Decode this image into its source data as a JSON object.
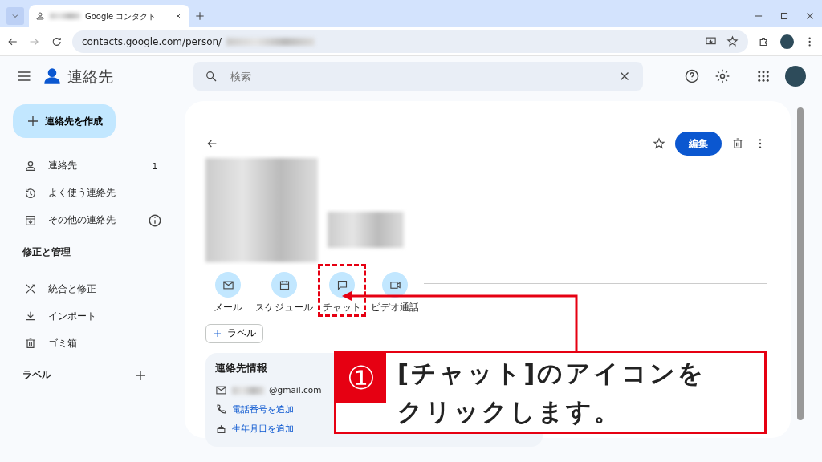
{
  "browser": {
    "tab_title": "Google コンタクト",
    "url": "contacts.google.com/person/"
  },
  "app": {
    "title": "連絡先",
    "search": {
      "placeholder": "検索"
    }
  },
  "sidebar": {
    "create_button": "連絡先を作成",
    "items": [
      {
        "label": "連絡先",
        "count": "1",
        "info": false
      },
      {
        "label": "よく使う連絡先",
        "info": false
      },
      {
        "label": "その他の連絡先",
        "info": true
      }
    ],
    "section_title": "修正と管理",
    "manage_items": [
      {
        "label": "統合と修正"
      },
      {
        "label": "インポート"
      },
      {
        "label": "ゴミ箱"
      }
    ],
    "labels_title": "ラベル"
  },
  "contact": {
    "edit_button": "編集",
    "actions": [
      {
        "label": "メール",
        "highlighted": false
      },
      {
        "label": "スケジュール",
        "highlighted": false
      },
      {
        "label": "チャット",
        "highlighted": true
      },
      {
        "label": "ビデオ通話",
        "highlighted": false
      }
    ],
    "label_button": "ラベル",
    "info_card": {
      "title": "連絡先情報",
      "rows": [
        {
          "kind": "value",
          "text": "@gmail.com"
        },
        {
          "kind": "link",
          "text": "電話番号を追加"
        },
        {
          "kind": "link",
          "text": "生年月日を追加"
        }
      ]
    }
  },
  "callout": {
    "number": "①",
    "lines": [
      "[チャット]のアイコンを",
      "クリックします。"
    ]
  }
}
